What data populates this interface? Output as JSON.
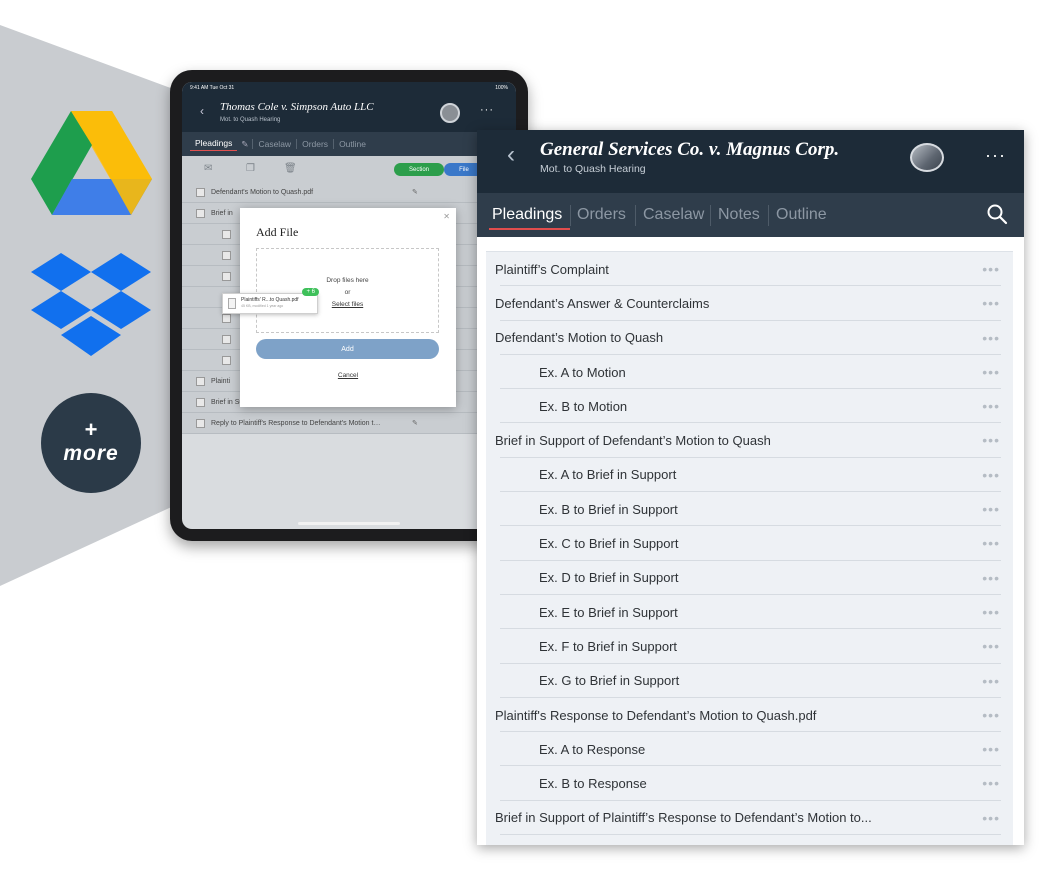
{
  "services": {
    "more_plus": "+",
    "more_label": "more"
  },
  "ipad": {
    "status_time": "9:41 AM   Tue Oct 31",
    "status_right": "100%",
    "title": "Thomas Cole v. Simpson Auto LLC",
    "subtitle": "Mot. to Quash Hearing",
    "tabs": [
      "Pleadings",
      "Caselaw",
      "Orders",
      "Outline"
    ],
    "section_btn": "Section",
    "file_btn": "File",
    "rows": [
      {
        "label": "Defendant's Motion to Quash.pdf",
        "indent": false
      },
      {
        "label": "Brief in",
        "indent": false
      },
      {
        "label": "",
        "indent": true
      },
      {
        "label": "",
        "indent": true
      },
      {
        "label": "",
        "indent": true
      },
      {
        "label": "",
        "indent": true
      },
      {
        "label": "",
        "indent": true
      },
      {
        "label": "",
        "indent": true
      },
      {
        "label": "",
        "indent": true
      },
      {
        "label": "Plainti",
        "indent": false
      },
      {
        "label": "Brief in Support of Plaintiff's Response to Defendan…",
        "indent": false
      },
      {
        "label": "Reply to Plaintiff's Response to Defendant's Motion t…",
        "indent": false
      }
    ],
    "modal": {
      "title": "Add File",
      "drop_text": "Drop files here",
      "or_text": "or",
      "select_files": "Select files",
      "add_btn": "Add",
      "cancel": "Cancel"
    },
    "drag_card": {
      "name": "Plaintiffs' R...to Quash.pdf",
      "meta": "45 KB, modified 1 year ago",
      "badge": "+ 6"
    }
  },
  "panel": {
    "title": "General Services Co. v. Magnus Corp.",
    "subtitle": "Mot. to Quash Hearing",
    "tabs": [
      "Pleadings",
      "Orders",
      "Caselaw",
      "Notes",
      "Outline"
    ],
    "rows": [
      {
        "label": "Plaintiff’s Complaint",
        "indent": false
      },
      {
        "label": "Defendant’s Answer & Counterclaims",
        "indent": false
      },
      {
        "label": "Defendant’s Motion to Quash",
        "indent": false
      },
      {
        "label": "Ex. A to Motion",
        "indent": true
      },
      {
        "label": "Ex. B to Motion",
        "indent": true
      },
      {
        "label": "Brief in Support of Defendant’s Motion to Quash",
        "indent": false
      },
      {
        "label": "Ex. A to Brief in Support",
        "indent": true
      },
      {
        "label": "Ex. B to Brief in Support",
        "indent": true
      },
      {
        "label": "Ex. C to Brief in Support",
        "indent": true
      },
      {
        "label": "Ex. D to Brief in Support",
        "indent": true
      },
      {
        "label": "Ex. E to Brief in Support",
        "indent": true
      },
      {
        "label": "Ex. F to Brief in Support",
        "indent": true
      },
      {
        "label": "Ex. G to Brief in Support",
        "indent": true
      },
      {
        "label": "Plaintiff's Response to Defendant’s Motion to Quash.pdf",
        "indent": false
      },
      {
        "label": "Ex. A to Response",
        "indent": true
      },
      {
        "label": "Ex. B to Response",
        "indent": true
      },
      {
        "label": "Brief in Support of Plaintiff’s Response to Defendant’s Motion to...",
        "indent": false
      }
    ],
    "row_menu": "•••"
  },
  "colors": {
    "header_bg": "#1d2b38",
    "tabs_bg": "#2f3d4b",
    "accent_red": "#e04d4d",
    "list_bg": "#eef1f5",
    "triangle": "#c9ccd0"
  }
}
